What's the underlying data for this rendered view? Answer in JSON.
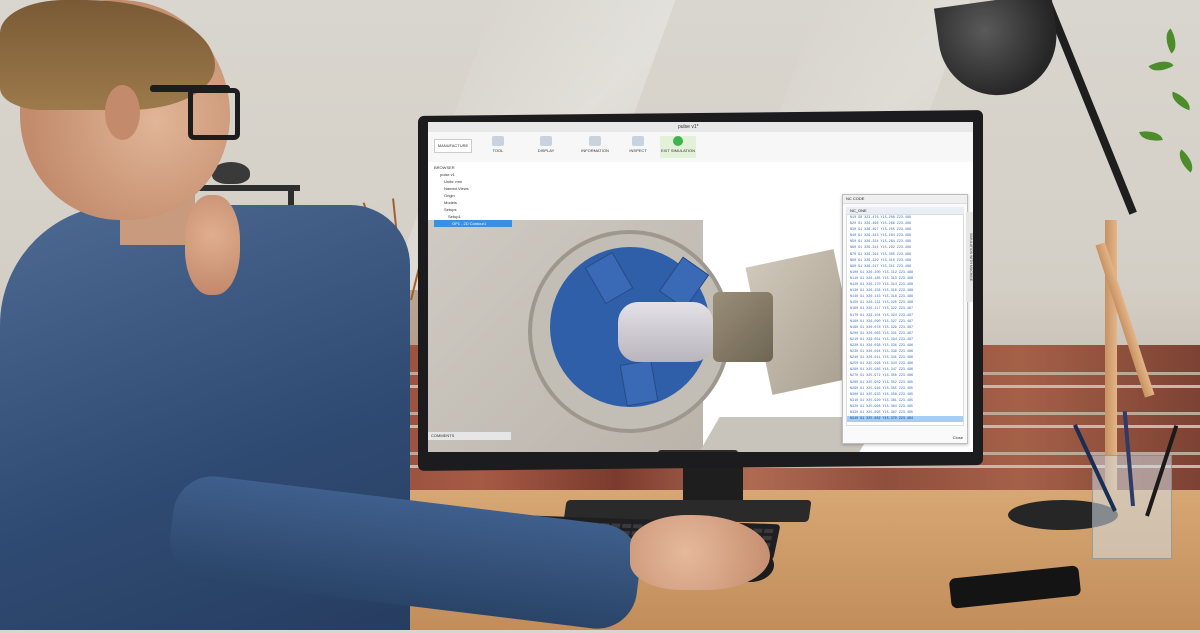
{
  "scene": {
    "description_colors": {
      "wall": "#d6d2ca",
      "desk": "#c99662",
      "brick": "#9a5040",
      "chuck_blue": "#2f5fa8",
      "shirt": "#3b5680"
    }
  },
  "app": {
    "document_title": "pulse v1*",
    "workspace_label": "MANUFACTURE",
    "toolbar_tabs": [
      "TOOL",
      "DISPLAY",
      "INFORMATION",
      "INSPECT",
      "EXIT SIMULATION"
    ],
    "browser_items": [
      "BROWSER",
      "pulse v1",
      "Units: mm",
      "Named Views",
      "Origin",
      "Models",
      "Setups",
      "Setup1",
      "OP1 - 2D Contour1"
    ],
    "comments_label": "COMMENTS",
    "nc_dialog": {
      "title": "NC CODE",
      "header": "NC_ONE",
      "lines": [
        "N10 G0 X23.476 Y15.208 Z23.489",
        "N20 G1 X26.496 Y15.268 Z23.489",
        "N30 G1 X26.497 Y15.255 Z23.489",
        "N40 G1 X26.343 Y15.264 Z23.489",
        "N50 G1 X26.324 Y15.284 Z23.489",
        "N60 G1 X26.314 Y15.292 Z23.489",
        "N70 G1 X26.294 Y15.305 Z23.489",
        "N80 G1 X26.229 Y15.310 Z23.488",
        "N90 G1 X26.217 Y15.311 Z23.488",
        "N100 G1 X26.200 Y15.312 Z23.488",
        "N110 G1 X26.185 Y15.313 Z23.488",
        "N120 G1 X26.170 Y15.314 Z23.488",
        "N130 G1 X26.158 Y15.316 Z23.488",
        "N140 G1 X26.143 Y15.318 Z23.488",
        "N150 G1 X26.131 Y15.320 Z23.488",
        "N160 G1 X26.117 Y15.322 Z23.487",
        "N170 G1 X26.104 Y15.324 Z23.487",
        "N180 G1 X26.090 Y15.327 Z23.487",
        "N190 G1 X26.078 Y15.329 Z23.487",
        "N200 G1 X26.063 Y15.331 Z23.487",
        "N210 G1 X26.051 Y15.334 Z23.487",
        "N220 G1 X26.038 Y15.336 Z23.486",
        "N230 G1 X26.024 Y15.339 Z23.486",
        "N240 G1 X26.011 Y15.341 Z23.486",
        "N250 G1 X25.998 Y15.344 Z23.486",
        "N260 G1 X25.985 Y15.347 Z23.486",
        "N270 G1 X25.972 Y15.350 Z23.486",
        "N280 G1 X25.959 Y15.352 Z23.485",
        "N290 G1 X25.946 Y15.355 Z23.485",
        "N300 G1 X25.933 Y15.358 Z23.485",
        "N310 G1 X25.920 Y15.361 Z23.485",
        "N320 G1 X25.908 Y15.364 Z23.485",
        "N330 G1 X25.895 Y15.367 Z23.485",
        "N340 G1 X25.882 Y15.370 Z23.484"
      ],
      "close_label": "Close"
    },
    "side_tab_label": "SIMULATION WITH MACHINE"
  }
}
